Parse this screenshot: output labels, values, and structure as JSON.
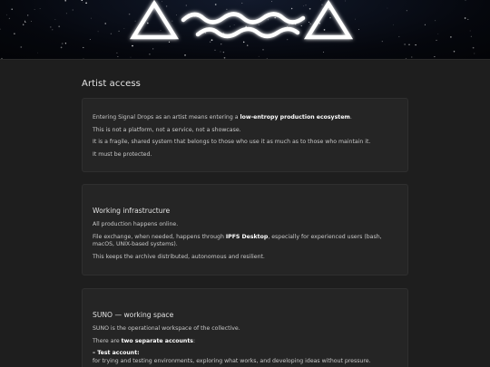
{
  "page_title": "Artist access",
  "card1": {
    "p1_pre": "Entering Signal Drops as an artist means entering a ",
    "p1_bold": "low-entropy production ecosystem",
    "p1_post": ".",
    "p2": "This is not a platform, not a service, not a showcase.",
    "p3": "It is a fragile, shared system that belongs to those who use it as much as to those who maintain it.",
    "p4": "It must be protected."
  },
  "card2": {
    "heading": "Working infrastructure",
    "p1": "All production happens online.",
    "p2_pre": "File exchange, when needed, happens through ",
    "p2_bold": "IPFS Desktop",
    "p2_post": ", especially for experienced users (bash, macOS, UNIX-based systems).",
    "p3": "This keeps the archive distributed, autonomous and resilient."
  },
  "card3": {
    "heading": "SUNO — working space",
    "p1": "SUNO is the operational workspace of the collective.",
    "p2_pre": "There are ",
    "p2_bold": "two separate accounts",
    "p2_post": ":",
    "item1_title": "– Test account:",
    "item1_text": "for trying and testing environments, exploring what works, and developing ideas without pressure."
  },
  "colors": {
    "background": "#1e1e1e",
    "card": "#252525",
    "banner": "#05070d",
    "logo": "#ffffff"
  },
  "icons": {
    "banner_logo": "triangle-wave-triangle-logo"
  }
}
